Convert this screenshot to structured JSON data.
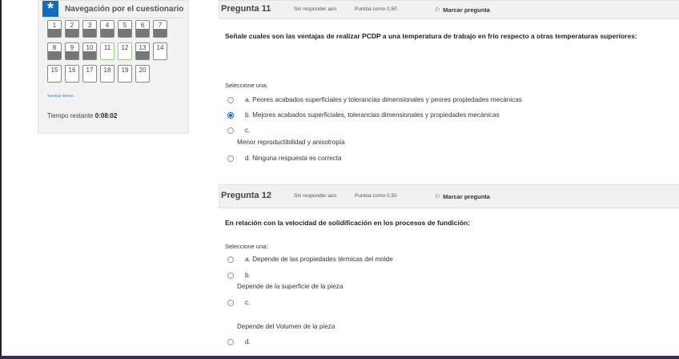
{
  "navigation": {
    "title": "Navegación por el cuestionario",
    "questions": [
      {
        "num": "1",
        "answered": true,
        "flagged": false
      },
      {
        "num": "2",
        "answered": true,
        "flagged": false
      },
      {
        "num": "3",
        "answered": true,
        "flagged": false
      },
      {
        "num": "4",
        "answered": true,
        "flagged": false
      },
      {
        "num": "5",
        "answered": true,
        "flagged": false
      },
      {
        "num": "6",
        "answered": true,
        "flagged": false
      },
      {
        "num": "7",
        "answered": true,
        "flagged": false
      },
      {
        "num": "8",
        "answered": true,
        "flagged": false
      },
      {
        "num": "9",
        "answered": true,
        "flagged": false
      },
      {
        "num": "10",
        "answered": true,
        "flagged": false
      },
      {
        "num": "11",
        "answered": false,
        "flagged": true
      },
      {
        "num": "12",
        "answered": false,
        "flagged": true
      },
      {
        "num": "13",
        "answered": true,
        "flagged": false
      },
      {
        "num": "14",
        "answered": false,
        "flagged": false
      },
      {
        "num": "15",
        "answered": false,
        "flagged": false
      },
      {
        "num": "16",
        "answered": false,
        "flagged": false
      },
      {
        "num": "17",
        "answered": false,
        "flagged": false
      },
      {
        "num": "18",
        "answered": false,
        "flagged": false
      },
      {
        "num": "19",
        "answered": false,
        "flagged": false
      },
      {
        "num": "20",
        "answered": false,
        "flagged": false
      }
    ],
    "finish_link": "Terminar intento...",
    "time_label": "Tiempo restante",
    "time_value": "0:08:02"
  },
  "q11": {
    "title": "Pregunta 11",
    "state": "Sin responder aún",
    "grade": "Puntúa como 0,50",
    "flag_label": "Marcar pregunta",
    "text": "Señale cuales son las ventajas de realizar PCDP a una temperatura de trabajo en frio respecto a otras temperaturas superiores:",
    "prompt": "Seleccione una:",
    "options": [
      "a. Peores acabados superficiales y tolerancias dimensionales y peores propiedades mecánicas",
      "b. Mejores acabados superficiales, tolerancias dimensionales y propiedades mecánicas",
      "c.",
      "d. Ninguna respuesta es correcta"
    ],
    "option_c_text": "Menor reproductibilidad y anisotropía",
    "selected": "b"
  },
  "q12": {
    "title": "Pregunta 12",
    "state": "Sin responder aún",
    "grade": "Puntúa como 0,50",
    "flag_label": "Marcar pregunta",
    "text": "En relación con la velocidad de solidificación en los procesos de fundición:",
    "prompt": "Seleccione una:",
    "options": [
      "a. Depende de las propiedades térmicas del molde",
      "b.",
      "c.",
      "d."
    ],
    "option_b_text": "Depende de la superficie de la pieza",
    "option_c_text": "Depende del Volumen de la pieza"
  },
  "colors": {
    "accent": "#0f6cbf",
    "answered": "#777777",
    "flagged_border": "#9bd17a"
  },
  "icons": {
    "nav": "asterisk-icon",
    "flag": "flag-icon",
    "radio": "radio-icon"
  }
}
